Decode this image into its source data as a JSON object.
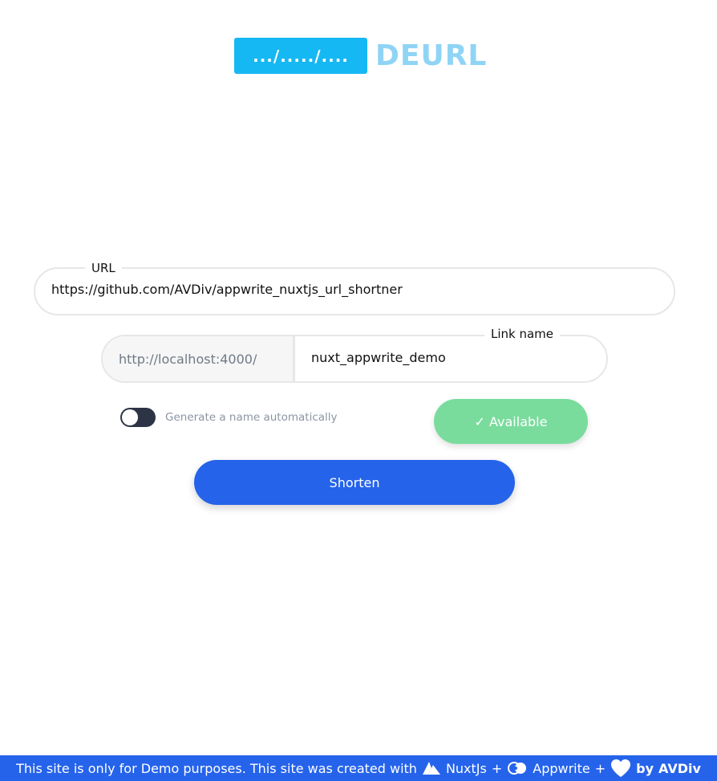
{
  "logo": {
    "box_text": ".../...../....",
    "brand_text": "DEURL"
  },
  "url_field": {
    "label": "URL",
    "value": "https://github.com/AVDiv/appwrite_nuxtjs_url_shortner"
  },
  "link_field": {
    "prefix": "http://localhost:4000/",
    "label": "Link name",
    "value": "nuxt_appwrite_demo"
  },
  "toggle": {
    "label": "Generate a name automatically",
    "on": false
  },
  "availability": {
    "label": "✓ Available"
  },
  "shorten_button": {
    "label": "Shorten"
  },
  "footer": {
    "text": "This site is only for Demo purposes. This site was created with",
    "nuxt": "NuxtJs",
    "plus1": "+",
    "appwrite": "Appwrite",
    "plus2": "+",
    "by": "by",
    "author": "AVDiv"
  },
  "colors": {
    "primary": "#2563eb",
    "logo_box": "#16b8f3",
    "logo_text": "#8fd4f5",
    "available": "#79dc9d",
    "toggle_off": "#2d3446"
  },
  "icons": [
    "nuxt-icon",
    "appwrite-icon",
    "heart-icon"
  ]
}
